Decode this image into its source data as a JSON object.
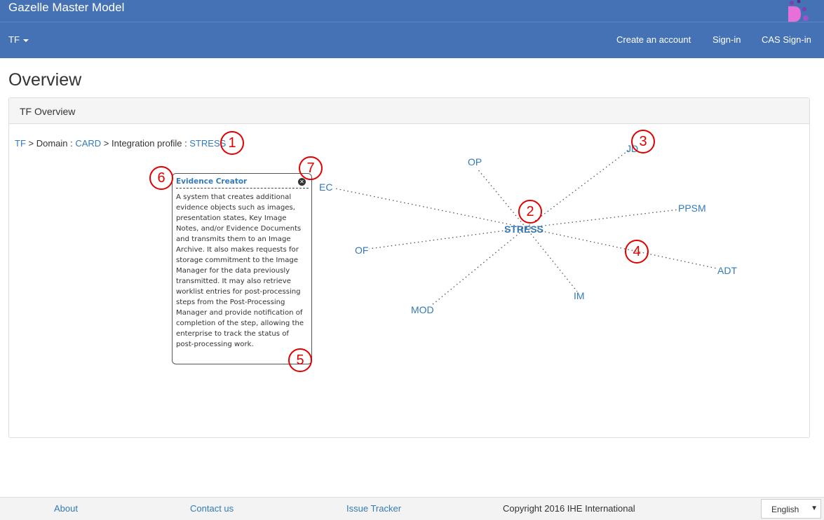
{
  "header": {
    "app_title": "Gazelle Master Model",
    "menu_label": "TF",
    "links": [
      "Create an account",
      "Sign-in",
      "CAS Sign-in"
    ]
  },
  "page": {
    "title": "Overview",
    "panel_title": "TF Overview"
  },
  "breadcrumb": {
    "root": "TF",
    "sep1": " > Domain : ",
    "domain": "CARD",
    "sep2": " > Integration profile : ",
    "profile": "STRESS"
  },
  "diagram": {
    "center": "STRESS",
    "nodes": [
      "OP",
      "JD",
      "PPSM",
      "ADT",
      "IM",
      "MOD",
      "OF",
      "EC"
    ]
  },
  "tooltip": {
    "title": "Evidence Creator",
    "body": "A system that creates additional evidence objects such as images, presentation states, Key Image Notes, and/or Evidence Documents and transmits them to an Image Archive. It also makes requests for storage commitment to the Image Manager for the data previously transmitted. It may also retrieve worklist entries for post-processing steps from the Post-Processing Manager and provide notification of completion of the step, allowing the enterprise to track the status of post-processing work."
  },
  "markers": [
    "1",
    "2",
    "3",
    "4",
    "5",
    "6",
    "7"
  ],
  "footer": {
    "about": "About",
    "contact": "Contact us",
    "issues": "Issue Tracker",
    "copyright": "Copyright 2016 IHE International",
    "language": "English"
  },
  "colors": {
    "header_bg": "#4472b4",
    "link": "#337ab7",
    "marker": "#e00000"
  }
}
